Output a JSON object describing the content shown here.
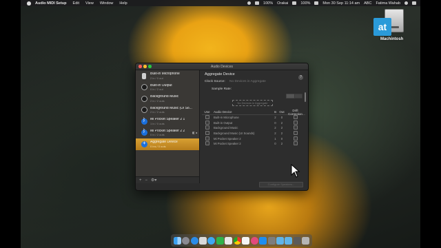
{
  "menubar": {
    "app_name": "Audio MIDI Setup",
    "menus": [
      "Edit",
      "View",
      "Window",
      "Help"
    ],
    "battery": "100%",
    "network": "Orakai",
    "wifi_strength": "100%",
    "date_time": "Mon 30 Sep 11:14 am",
    "input_source": "ABC",
    "user": "Fatima Wahab"
  },
  "desktop": {
    "logo_text": "at",
    "drive_label": "Machintosh"
  },
  "window": {
    "title": "Audio Devices",
    "devices": [
      {
        "name": "Built-in Microphone",
        "sub": "2 in / 0 out",
        "icon": "microphone-icon"
      },
      {
        "name": "Built-in Output",
        "sub": "0 in / 2 out",
        "icon": "speaker-icon"
      },
      {
        "name": "Background Music",
        "sub": "2 in / 2 outs",
        "icon": "speaker-icon"
      },
      {
        "name": "Background Music (UI So...",
        "sub": "2 in / 2 outs",
        "icon": "speaker-icon"
      },
      {
        "name": "Mi Pocket Speaker 2 1",
        "sub": "1 in / 0 outs",
        "icon": "bluetooth-icon"
      },
      {
        "name": "Mi Pocket Speaker 2 2",
        "sub": "0 in / 2 outs",
        "icon": "bluetooth-icon"
      },
      {
        "name": "Aggregate Device",
        "sub": "0 ins / 0 outs",
        "icon": "aggregate-icon",
        "selected": true
      }
    ],
    "footer": {
      "add": "+",
      "remove": "−",
      "gear": "⚙▾"
    },
    "detail": {
      "title": "Aggregate Device",
      "clock_label": "Clock Source:",
      "clock_value": "No Devices in Aggregate",
      "rate_label": "Sample Rate:",
      "dashed_text": "No Devices in Aggregate",
      "help": "?",
      "table_headers": {
        "use": "Use",
        "device": "Audio Device",
        "in": "In",
        "out": "Out",
        "drift": "Drift Correction"
      },
      "table_rows": [
        {
          "device": "Built-in Microphone",
          "in": "2",
          "out": "0"
        },
        {
          "device": "Built-in Output",
          "in": "0",
          "out": "2"
        },
        {
          "device": "Background Music",
          "in": "2",
          "out": "2"
        },
        {
          "device": "Background Music (UI Sounds)",
          "in": "2",
          "out": "2"
        },
        {
          "device": "Mi Pocket Speaker 2",
          "in": "1",
          "out": "0"
        },
        {
          "device": "Mi Pocket Speaker 2",
          "in": "0",
          "out": "2"
        }
      ],
      "bottom_button": "Configure Speakers..."
    }
  },
  "dock_apps": [
    "finder",
    "launchpad",
    "safari",
    "mail",
    "messages",
    "facetime",
    "photos",
    "chrome",
    "calendar",
    "itunes",
    "app-store",
    "system-preferences",
    "folder",
    "folder",
    "audio-midi",
    "trash"
  ]
}
